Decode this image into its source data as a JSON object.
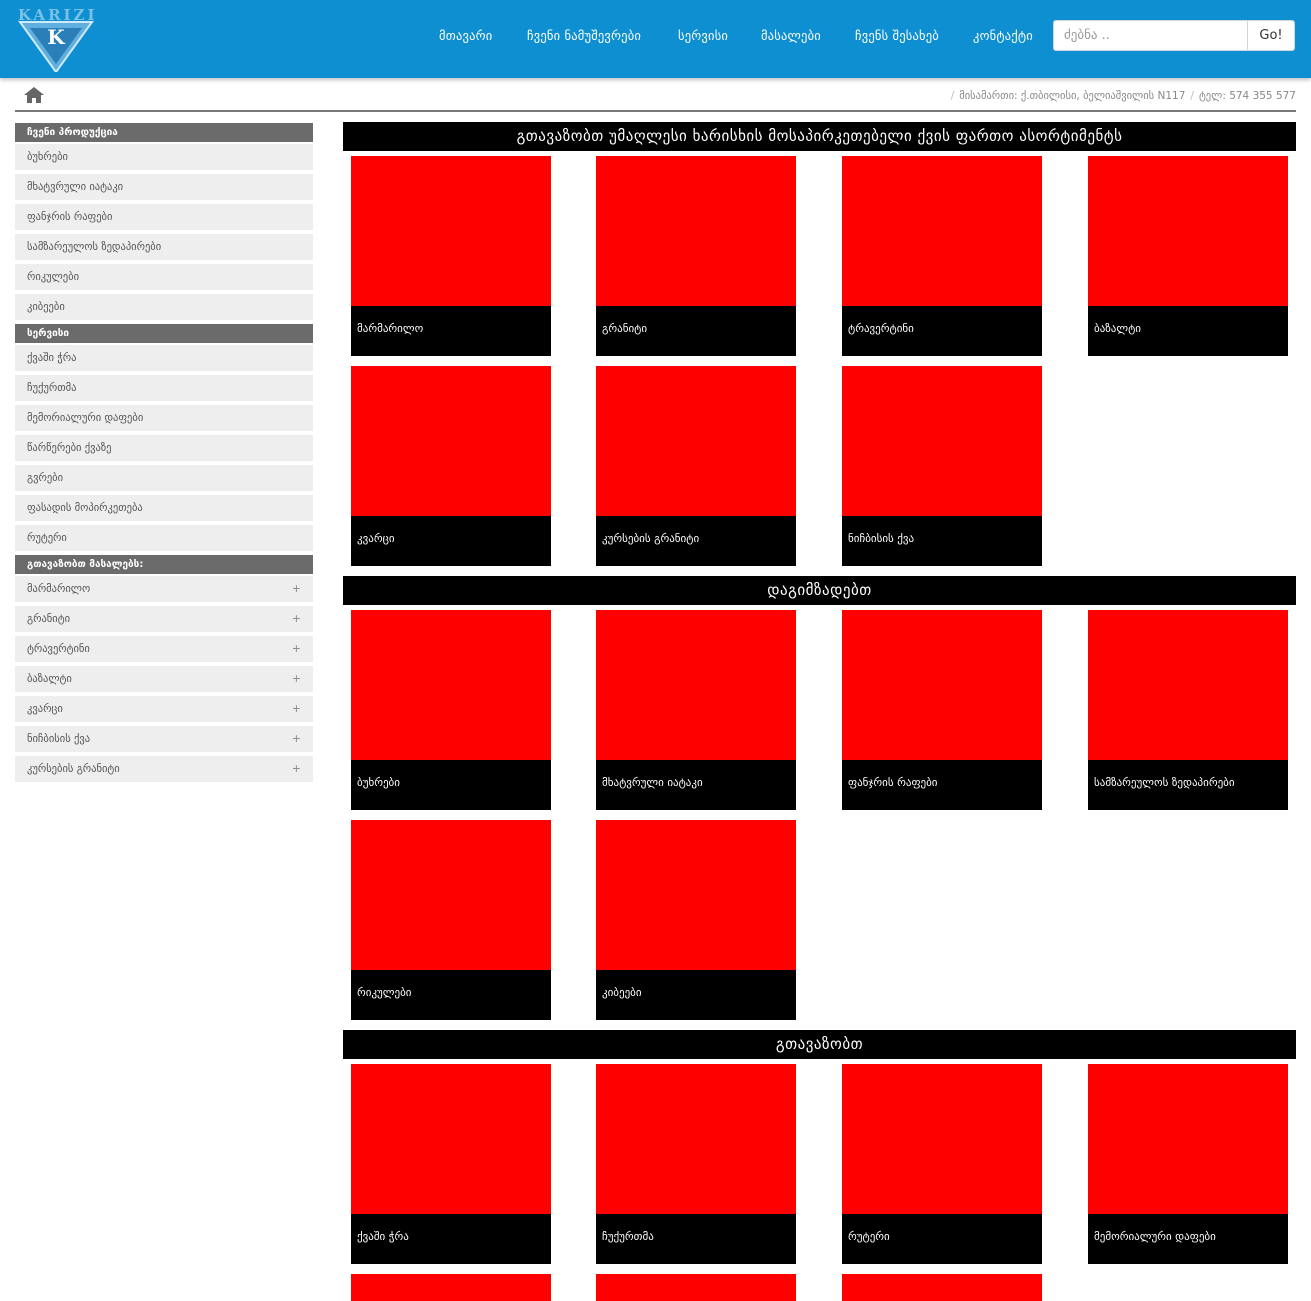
{
  "brand": {
    "logo_text": "KARIZI",
    "logo_letter": "K",
    "header_color": "#0e8fd1"
  },
  "nav": [
    {
      "label": "მთავარი"
    },
    {
      "label": "ჩვენი ნამუშევრები"
    },
    {
      "label": "სერვისი"
    },
    {
      "label": "მასალები"
    },
    {
      "label": "ჩვენს შესახებ"
    },
    {
      "label": "კონტაქტი"
    }
  ],
  "search": {
    "placeholder": "ძებნა ..",
    "button_label": "Go!"
  },
  "breadcrumb": {
    "home_icon": "home-icon",
    "address": "მისამართი: ქ.თბილისი, ბელიაშვილის N117",
    "phone": "ტელ: 574 355 577"
  },
  "sidebar": {
    "products_header": "ჩვენი პროდუქცია",
    "products": [
      "ბუხრები",
      "მხატვრული იატაკი",
      "ფანჯრის რაფები",
      "სამზარეულოს ზედაპირები",
      "რიკულები",
      "კიბეები"
    ],
    "service_header": "სერვისი",
    "services": [
      "ქვაში ჭრა",
      "ჩუქურთმა",
      "მემორიალური დაფები",
      "წარწერები ქვაზე",
      "გვრები",
      "ფასადის მოპირკეთება",
      "რუტერი"
    ],
    "materials_header": "გთავაზობთ მასალებს:",
    "materials": [
      "მარმარილო",
      "გრანიტი",
      "ტრავერტინი",
      "ბაზალტი",
      "კვარცი",
      "ნიჩბისის ქვა",
      "კურსების გრანიტი"
    ],
    "expand_symbol": "+"
  },
  "sections": [
    {
      "title": "გთავაზობთ უმაღლესი ხარისხის მოსაპირკეთებელი ქვის ფართო ასორტიმენტს",
      "tiles": [
        "მარმარილო",
        "გრანიტი",
        "ტრავერტინი",
        "ბაზალტი",
        "კვარცი",
        "კურსების გრანიტი",
        "ნიჩბისის ქვა"
      ]
    },
    {
      "title": "დაგიმზადებთ",
      "tiles": [
        "ბუხრები",
        "მხატვრული იატაკი",
        "ფანჯრის რაფები",
        "სამზარეულოს ზედაპირები",
        "რიკულები",
        "კიბეები"
      ]
    },
    {
      "title": "გთავაზობთ",
      "tiles": [
        "ქვაში ჭრა",
        "ჩუქურთმა",
        "რუტერი",
        "მემორიალური დაფები"
      ]
    }
  ],
  "colors": {
    "tile_image": "#ff0000",
    "tile_label_bg": "#000000",
    "sidebar_header": "#6b6b6b",
    "sidebar_item": "#eeeeee"
  }
}
